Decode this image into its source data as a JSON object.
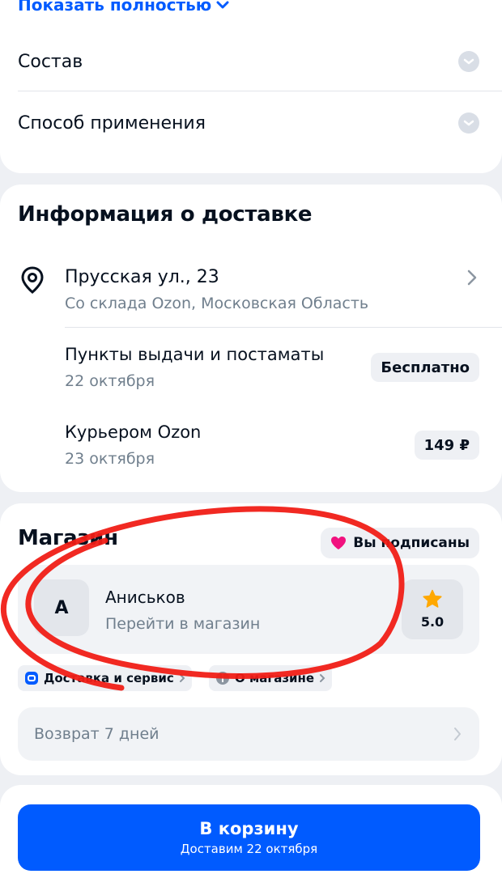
{
  "details": {
    "show_more": "Показать полностью",
    "accordion": [
      {
        "label": "Состав"
      },
      {
        "label": "Способ применения"
      }
    ]
  },
  "delivery": {
    "title": "Информация о доставке",
    "address": "Прусская ул., 23",
    "warehouse": "Со склада Ozon, Московская Область",
    "options": [
      {
        "title": "Пункты выдачи и постаматы",
        "date": "22 октября",
        "price": "Бесплатно"
      },
      {
        "title": "Курьером Ozon",
        "date": "23 октября",
        "price": "149 ₽"
      }
    ]
  },
  "store": {
    "title": "Магазин",
    "subscribe_label": "Вы подписаны",
    "seller_initial": "А",
    "seller_name": "Аниськов",
    "go_to_store": "Перейти в магазин",
    "rating": "5.0",
    "chips": [
      "Доставка и сервис",
      "О магазине"
    ],
    "return_policy": "Возврат 7 дней"
  },
  "cart": {
    "label": "В корзину",
    "sublabel": "Доставим 22 октября"
  },
  "colors": {
    "accent": "#005bff",
    "heart": "#f1117e",
    "star": "#ffa800",
    "annotation": "#f01e16"
  }
}
